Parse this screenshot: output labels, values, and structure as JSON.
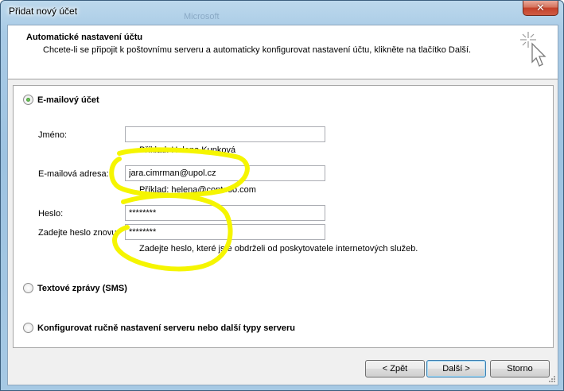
{
  "window": {
    "title": "Přidat nový účet",
    "ghost_text": "Microsoft",
    "close_glyph": "✕"
  },
  "header": {
    "title": "Automatické nastavení účtu",
    "subtitle": "Chcete-li se připojit k poštovnímu serveru a automaticky konfigurovat nastavení účtu, klikněte na tlačítko Další.",
    "icon": "wizard-wand-icon"
  },
  "options": {
    "email_account": {
      "label": "E-mailový účet",
      "checked": true
    },
    "sms": {
      "label": "Textové zprávy (SMS)",
      "checked": false
    },
    "manual": {
      "label": "Konfigurovat ručně nastavení serveru nebo další typy serveru",
      "checked": false
    }
  },
  "form": {
    "name": {
      "label": "Jméno:",
      "value": "",
      "hint": "Příklad: Helena Kupková"
    },
    "email": {
      "label": "E-mailová adresa:",
      "value": "jara.cimrman@upol.cz",
      "hint": "Příklad: helena@contoso.com"
    },
    "password": {
      "label": "Heslo:",
      "value": "********"
    },
    "password_repeat": {
      "label": "Zadejte heslo znovu:",
      "value": "********"
    },
    "password_hint": "Zadejte heslo, které jste obdrželi od poskytovatele internetových služeb."
  },
  "buttons": {
    "back": "< Zpět",
    "next": "Další >",
    "cancel": "Storno"
  },
  "colors": {
    "annotation": "#ffff00",
    "frame": "#a9cbe6",
    "close": "#c4412a"
  }
}
